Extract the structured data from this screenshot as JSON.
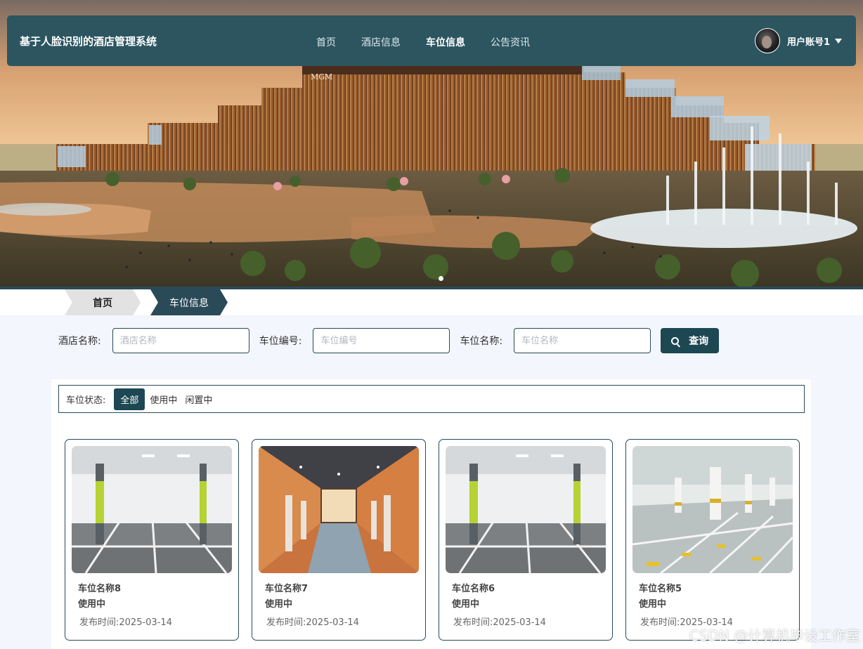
{
  "header": {
    "brand": "基于人脸识别的酒店管理系统",
    "nav": [
      {
        "label": "首页",
        "active": false
      },
      {
        "label": "酒店信息",
        "active": false
      },
      {
        "label": "车位信息",
        "active": true
      },
      {
        "label": "公告资讯",
        "active": false
      }
    ],
    "user": {
      "name": "用户账号1",
      "menu_icon": "caret-down-icon"
    }
  },
  "hero": {
    "building_sign": "MGM",
    "slide_count": 1,
    "active_slide": 1
  },
  "breadcrumb": {
    "home": "首页",
    "current": "车位信息"
  },
  "search": {
    "hotel_label": "酒店名称:",
    "hotel_placeholder": "酒店名称",
    "code_label": "车位编号:",
    "code_placeholder": "车位编号",
    "name_label": "车位名称:",
    "name_placeholder": "车位名称",
    "button_label": "查询",
    "button_icon": "search-icon"
  },
  "filter": {
    "label": "车位状态:",
    "options": [
      {
        "label": "全部",
        "active": true
      },
      {
        "label": "使用中",
        "active": false
      },
      {
        "label": "闲置中",
        "active": false
      }
    ]
  },
  "cards": [
    {
      "name": "车位名称8",
      "status": "使用中",
      "date": "发布时间:2025-03-14",
      "image": "white-garage"
    },
    {
      "name": "车位名称7",
      "status": "使用中",
      "date": "发布时间:2025-03-14",
      "image": "orange-tunnel"
    },
    {
      "name": "车位名称6",
      "status": "使用中",
      "date": "发布时间:2025-03-14",
      "image": "white-garage"
    },
    {
      "name": "车位名称5",
      "status": "使用中",
      "date": "发布时间:2025-03-14",
      "image": "pillar-hall"
    }
  ],
  "watermark": "CSDN @计算机毕设工作室",
  "colors": {
    "navbar": "#2c5560",
    "primary": "#1d4753",
    "page_bg": "#f3f6fc"
  }
}
